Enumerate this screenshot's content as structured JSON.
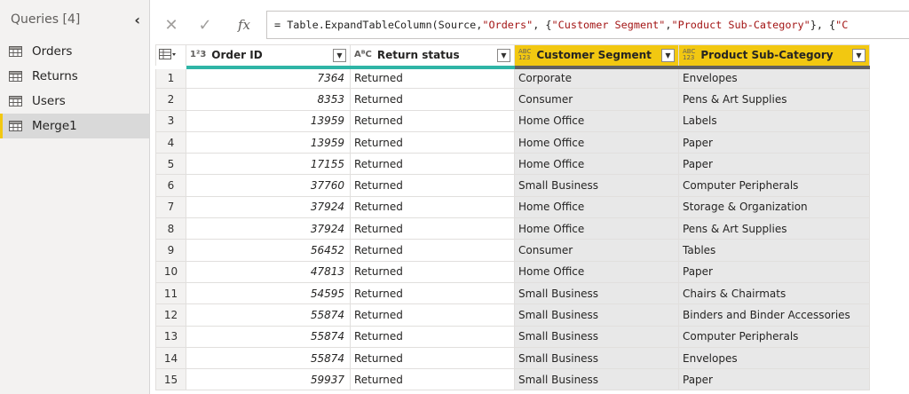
{
  "queries": {
    "title": "Queries [4]",
    "collapse_glyph": "‹",
    "items": [
      {
        "label": "Orders",
        "selected": false
      },
      {
        "label": "Returns",
        "selected": false
      },
      {
        "label": "Users",
        "selected": false
      },
      {
        "label": "Merge1",
        "selected": true
      }
    ]
  },
  "formula_bar": {
    "cancel_glyph": "✕",
    "commit_glyph": "✓",
    "fx_label": "fx",
    "parts": [
      {
        "text": "= Table.ExpandTableColumn(Source, ",
        "kind": "plain"
      },
      {
        "text": "\"Orders\"",
        "kind": "str"
      },
      {
        "text": ", {",
        "kind": "plain"
      },
      {
        "text": "\"Customer Segment\"",
        "kind": "str"
      },
      {
        "text": ", ",
        "kind": "plain"
      },
      {
        "text": "\"Product Sub-Category\"",
        "kind": "str"
      },
      {
        "text": "}, {",
        "kind": "plain"
      },
      {
        "text": "\"C",
        "kind": "str"
      }
    ]
  },
  "grid": {
    "columns": [
      {
        "label": "Order ID",
        "type_icon": "1²3"
      },
      {
        "label": "Return status",
        "type_icon": "AᴮC"
      },
      {
        "label": "Customer Segment",
        "type_icon": "ABC123"
      },
      {
        "label": "Product Sub-Category",
        "type_icon": "ABC123"
      }
    ],
    "rows": [
      {
        "n": "1",
        "id": "7364",
        "status": "Returned",
        "segment": "Corporate",
        "subcat": "Envelopes"
      },
      {
        "n": "2",
        "id": "8353",
        "status": "Returned",
        "segment": "Consumer",
        "subcat": "Pens & Art Supplies"
      },
      {
        "n": "3",
        "id": "13959",
        "status": "Returned",
        "segment": "Home Office",
        "subcat": "Labels"
      },
      {
        "n": "4",
        "id": "13959",
        "status": "Returned",
        "segment": "Home Office",
        "subcat": "Paper"
      },
      {
        "n": "5",
        "id": "17155",
        "status": "Returned",
        "segment": "Home Office",
        "subcat": "Paper"
      },
      {
        "n": "6",
        "id": "37760",
        "status": "Returned",
        "segment": "Small Business",
        "subcat": "Computer Peripherals"
      },
      {
        "n": "7",
        "id": "37924",
        "status": "Returned",
        "segment": "Home Office",
        "subcat": "Storage & Organization"
      },
      {
        "n": "8",
        "id": "37924",
        "status": "Returned",
        "segment": "Home Office",
        "subcat": "Pens & Art Supplies"
      },
      {
        "n": "9",
        "id": "56452",
        "status": "Returned",
        "segment": "Consumer",
        "subcat": "Tables"
      },
      {
        "n": "10",
        "id": "47813",
        "status": "Returned",
        "segment": "Home Office",
        "subcat": "Paper"
      },
      {
        "n": "11",
        "id": "54595",
        "status": "Returned",
        "segment": "Small Business",
        "subcat": "Chairs & Chairmats"
      },
      {
        "n": "12",
        "id": "55874",
        "status": "Returned",
        "segment": "Small Business",
        "subcat": "Binders and Binder Accessories"
      },
      {
        "n": "13",
        "id": "55874",
        "status": "Returned",
        "segment": "Small Business",
        "subcat": "Computer Peripherals"
      },
      {
        "n": "14",
        "id": "55874",
        "status": "Returned",
        "segment": "Small Business",
        "subcat": "Envelopes"
      },
      {
        "n": "15",
        "id": "59937",
        "status": "Returned",
        "segment": "Small Business",
        "subcat": "Paper"
      }
    ]
  },
  "colors": {
    "selected_column_header": "#f2c811",
    "quality_bar": "#2fb5a6",
    "selected_query_accent": "#f2c811",
    "formula_string": "#a31515"
  }
}
